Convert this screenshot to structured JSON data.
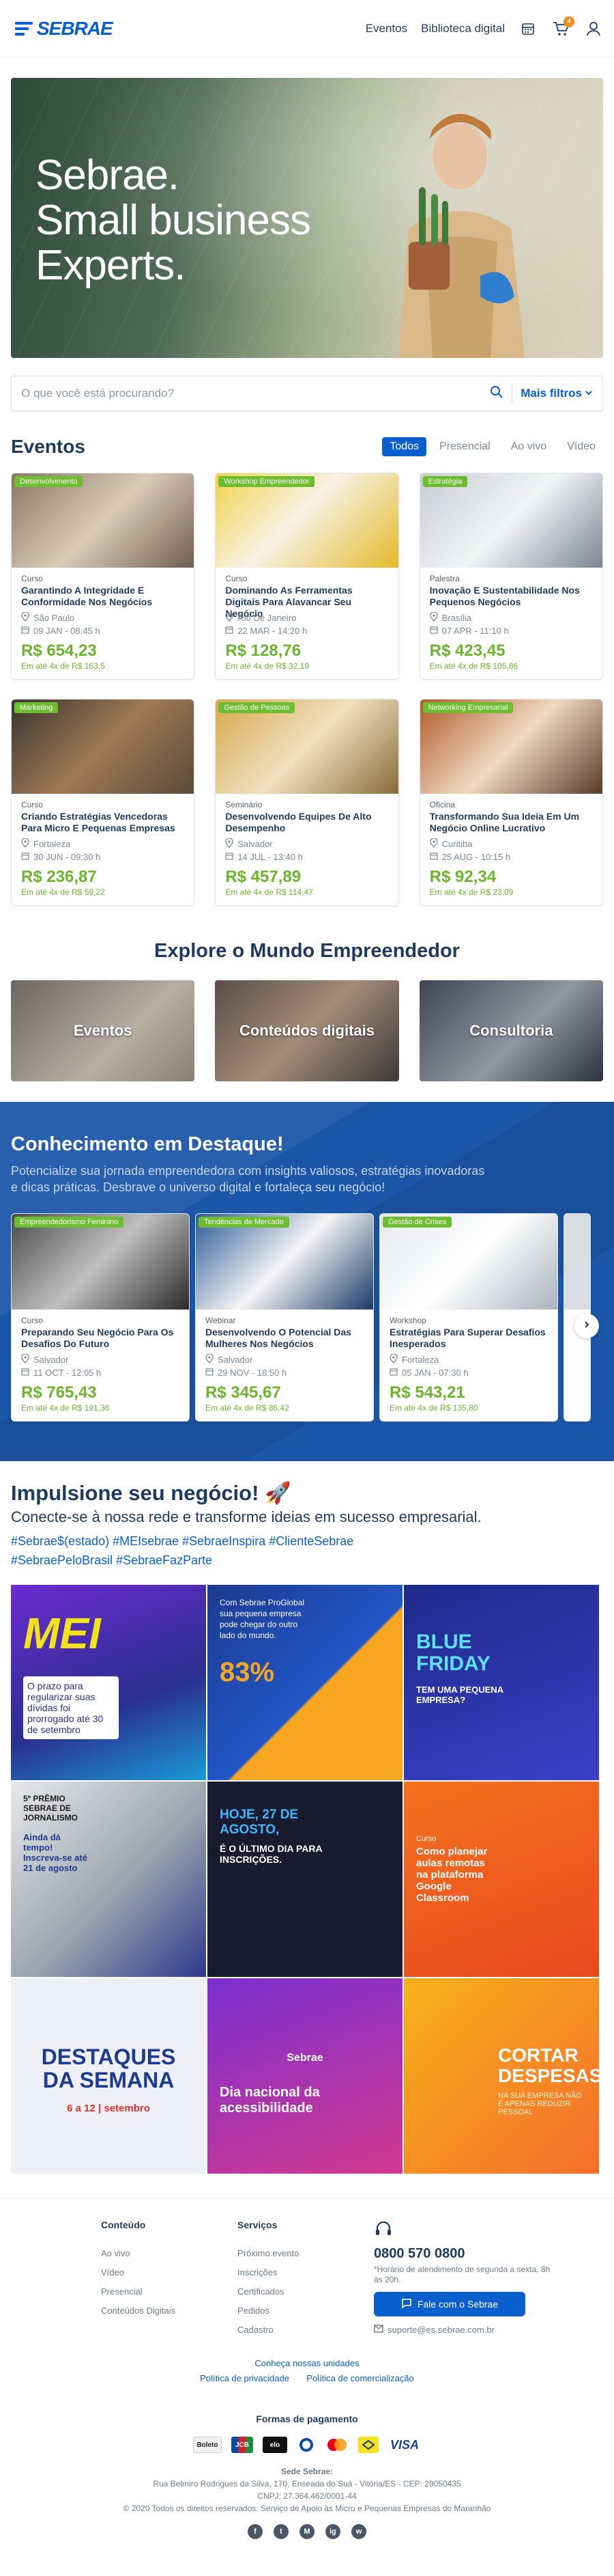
{
  "header": {
    "logo_text": "SEBRAE",
    "nav": [
      "Eventos",
      "Biblioteca digital"
    ],
    "cart_count": "4"
  },
  "hero": {
    "line1": "Sebrae.",
    "line2": "Small business",
    "line3": "Experts."
  },
  "search": {
    "placeholder": "O que você está procurando?",
    "filters_label": "Mais filtros"
  },
  "events": {
    "title": "Eventos",
    "tabs": [
      "Todos",
      "Presencial",
      "Ao vivo",
      "Vídeo"
    ],
    "cards": [
      {
        "tag": "Desenvolvimento",
        "type": "Curso",
        "title": "Garantindo A Integridade E Conformidade Nos Negócios",
        "city": "São Paulo",
        "date": "09 JAN - 08:45 h",
        "price": "R$ 654,23",
        "inst": "Em até 4x de  R$ 163,5",
        "tag_color": "#6cbe30"
      },
      {
        "tag": "Workshop Empreendedor",
        "type": "Curso",
        "title": "Dominando As Ferramentas Digitais Para Alavancar Seu Negócio",
        "city": "Rio De Janeiro",
        "date": "22 MAR - 14:20 h",
        "price": "R$ 128,76",
        "inst": "Em até 4x de  R$ 32,19",
        "tag_color": "#6cbe30"
      },
      {
        "tag": "Estratégia",
        "type": "Palestra",
        "title": "Inovação E Sustentabilidade Nos Pequenos Negócios",
        "city": "Brasília",
        "date": "07 APR - 11:10 h",
        "price": "R$ 423,45",
        "inst": "Em até 4x de  R$ 105,86",
        "tag_color": "#6cbe30"
      },
      {
        "tag": "Marketing",
        "type": "Curso",
        "title": "Criando Estratégias Vencedoras Para Micro E Pequenas Empresas",
        "city": "Fortaleza",
        "date": "30 JUN - 09:30 h",
        "price": "R$ 236,87",
        "inst": "Em até 4x de  R$ 59,22",
        "tag_color": "#6cbe30"
      },
      {
        "tag": "Gestão de Pessoas",
        "type": "Seminário",
        "title": "Desenvolvendo Equipes De Alto Desempenho",
        "city": "Salvador",
        "date": "14 JUL - 13:40 h",
        "price": "R$ 457,89",
        "inst": "Em até 4x de  R$ 114,47",
        "tag_color": "#6cbe30"
      },
      {
        "tag": "Networking Empresarial",
        "type": "Oficina",
        "title": "Transformando Sua Ideia Em Um Negócio Online Lucrativo",
        "city": "Curitiba",
        "date": "25 AUG - 10:15 h",
        "price": "R$ 92,34",
        "inst": "Em até 4x de  R$ 23,09",
        "tag_color": "#6cbe30"
      }
    ]
  },
  "explore": {
    "title": "Explore o Mundo Empreendedor",
    "tiles": [
      "Eventos",
      "Conteúdos digitais",
      "Consultoria"
    ]
  },
  "knowledge": {
    "title": "Conhecimento em Destaque!",
    "text": "Potencialize sua jornada empreendedora com insights valiosos, estratégias inovadoras e dicas práticas. Desbrave o universo digital e fortaleça seu negócio!",
    "cards": [
      {
        "tag": "Empreendedorismo Feminino",
        "type": "Curso",
        "title": "Preparando Seu Negócio Para Os Desafios Do Futuro",
        "city": "Salvador",
        "date": "11 OCT - 12:05 h",
        "price": "R$ 765,43",
        "inst": "Em até 4x de  R$ 191,36"
      },
      {
        "tag": "Tendências de Mercado",
        "type": "Webinar",
        "title": "Desenvolvendo O Potencial Das Mulheres Nos Negócios",
        "city": "Salvador",
        "date": "29 NOV - 18:50 h",
        "price": "R$ 345,67",
        "inst": "Em até 4x de  R$ 86,42"
      },
      {
        "tag": "Gestão de Crises",
        "type": "Workshop",
        "title": "Estratégias Para Superar Desafios Inesperados",
        "city": "Fortaleza",
        "date": "05 JAN - 07:30 h",
        "price": "R$ 543,21",
        "inst": "Em até 4x de  R$ 135,80"
      }
    ]
  },
  "impulse": {
    "title": "Impulsione seu negócio! 🚀",
    "subtitle": "Conecte-se à nossa rede e transforme ideias em sucesso empresarial.",
    "tags1": "#Sebrae$(estado) #MEIsebrae #SebraeInspira #ClienteSebrae",
    "tags2": "#SebraePeloBrasil #SebraeFazParte",
    "posts": [
      {
        "title": "MEI",
        "text": "O prazo para regularizar suas dívidas foi prorrogado até 30 de setembro"
      },
      {
        "title": "83%",
        "text": "Com Sebrae ProGlobal sua pequena empresa pode chegar do outro lado do mundo."
      },
      {
        "title": "BLUE FRIDAY",
        "text": "TEM UMA PEQUENA EMPRESA?"
      },
      {
        "title": "5º PRÊMIO SEBRAE DE JORNALISMO",
        "text": "Ainda dá tempo! Inscreva-se até 21 de agosto"
      },
      {
        "title": "HOJE, 27 DE AGOSTO,",
        "text": "É O ÚLTIMO DIA PARA INSCRIÇÕES."
      },
      {
        "title": "Como planejar aulas remotas na plataforma Google Classroom",
        "text": "Curso"
      },
      {
        "title": "DESTAQUES DA SEMANA",
        "text": "6 a 12 | setembro"
      },
      {
        "title": "Dia nacional da acessibilidade",
        "text": "Sebrae"
      },
      {
        "title": "CORTAR DESPESAS",
        "text": "NA SUA EMPRESA NÃO É APENAS REDUZIR PESSOAL"
      }
    ]
  },
  "footer": {
    "col1_title": "Conteúdo",
    "col1": [
      "Ao vivo",
      "Vídeo",
      "Presencial",
      "Conteúdos Digitais"
    ],
    "col2_title": "Serviços",
    "col2": [
      "Próximo evento",
      "Inscrições",
      "Certificados",
      "Pedidos",
      "Cadastro"
    ],
    "phone": "0800 570 0800",
    "hours": "*Horário de atendimento de segunda a sexta, 8h às 20h.",
    "fale_label": "Fale com o Sebrae",
    "email": "suporte@es.sebrae.com.br",
    "links": [
      "Conheça nossas unidades",
      "Política de privacidade",
      "Política de comercialização"
    ],
    "payment_title": "Formas de pagamento",
    "payment_methods": [
      "Boleto",
      "JCB",
      "elo",
      "Diners",
      "Mastercard",
      "Banco",
      "VISA"
    ],
    "address_title": "Sede Sebrae:",
    "address": "Rua Belmiro Rodrigues da Silva, 170, Enseada do Suá - Vitória/ES - CEP: 29050435",
    "cnpj": "CNPJ: 27.364.462/0001-44",
    "copyright": "© 2020 Todos os direitos reservados. Serviço de Apoio às Micro e Pequenas Empresas do Maranhão",
    "socials": [
      "f",
      "t",
      "M",
      "ig",
      "w"
    ]
  }
}
